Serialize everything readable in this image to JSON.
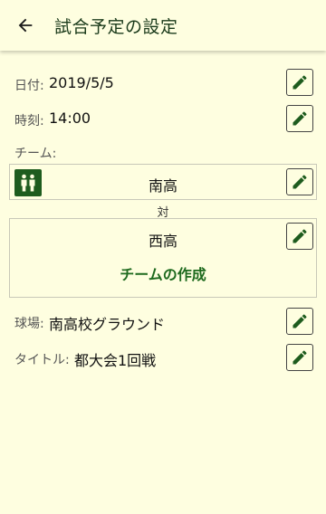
{
  "header": {
    "title": "試合予定の設定"
  },
  "form": {
    "date_label": "日付:",
    "date_value": "2019/5/5",
    "time_label": "時刻:",
    "time_value": "14:00",
    "team_label": "チーム:",
    "home_team": "南高",
    "vs_label": "対",
    "away_team": "西高",
    "create_team_label": "チームの作成",
    "venue_label": "球場:",
    "venue_value": "南高校グラウンド",
    "title_label": "タイトル:",
    "title_value": "都大会1回戦"
  },
  "colors": {
    "background": "#fefee0",
    "accent_green": "#1e5c1e",
    "create_team_text": "#1e6a1e"
  },
  "icons": {
    "back": "arrow-left-icon",
    "edit": "pencil-icon",
    "team": "people-icon"
  }
}
